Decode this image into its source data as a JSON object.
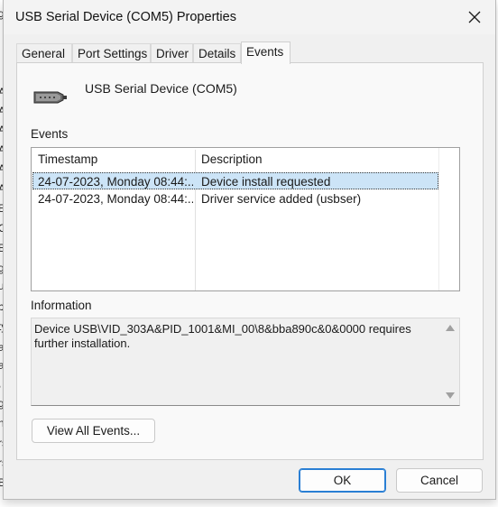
{
  "background_fragments": [
    "g",
    "A",
    "A",
    "A",
    "A",
    "A",
    "A",
    "E",
    "C",
    "B",
    "g",
    "u",
    "b",
    "ty",
    "a",
    "a",
    ",",
    "g",
    "n",
    "rs",
    "rs",
    "B"
  ],
  "window": {
    "title": "USB Serial Device (COM5) Properties",
    "close_icon": "close-icon"
  },
  "tabs": [
    {
      "label": "General",
      "active": false
    },
    {
      "label": "Port Settings",
      "active": false
    },
    {
      "label": "Driver",
      "active": false
    },
    {
      "label": "Details",
      "active": false
    },
    {
      "label": "Events",
      "active": true
    }
  ],
  "device": {
    "name": "USB Serial Device (COM5)",
    "icon": "serial-port-icon"
  },
  "events_section": {
    "label": "Events",
    "columns": [
      "Timestamp",
      "Description"
    ],
    "rows": [
      {
        "timestamp": "24-07-2023, Monday 08:44:...",
        "description": "Device install requested",
        "selected": true
      },
      {
        "timestamp": "24-07-2023, Monday 08:44:...",
        "description": "Driver service added (usbser)",
        "selected": false
      }
    ]
  },
  "information": {
    "label": "Information",
    "text": "Device USB\\VID_303A&PID_1001&MI_00\\8&bba890c&0&0000 requires further installation."
  },
  "buttons": {
    "view_all": "View All Events...",
    "ok": "OK",
    "cancel": "Cancel"
  },
  "colors": {
    "selection": "#cce4f7",
    "primary_border": "#2a7fd4",
    "dialog_bg": "#f0f0f0"
  }
}
